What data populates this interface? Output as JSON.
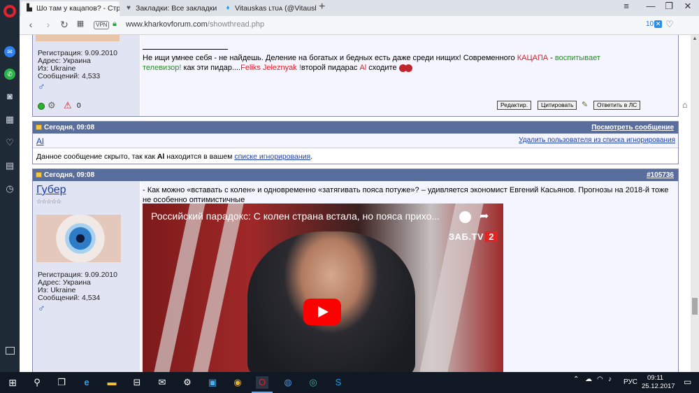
{
  "tabs": [
    {
      "title": "Шо там у кацапов? - Стра",
      "icon": "opera-page-icon",
      "active": true
    },
    {
      "title": "Закладки: Все закладки",
      "icon": "heart-icon",
      "active": false
    },
    {
      "title": "Vitauskas ʟтᴜᴀ (@Vitauskas",
      "icon": "twitter-icon",
      "active": false
    }
  ],
  "address": {
    "vpn": "VPN",
    "host": "www.kharkovforum.com",
    "path": "/showthread.php",
    "badge_count": "10"
  },
  "post1": {
    "reg": "Регистрация: 9.09.2010",
    "addr": "Адрес: Украина",
    "from": "Из: Ukraine",
    "msgs": "Сообщений: 4,533",
    "sig_line1_a": "Не ищи умнее себя - не найдешь. Деление на богатых и бедных есть даже среди нищих! Современного ",
    "sig_red1": "КАЦАПА",
    "sig_sep": " - ",
    "sig_green1": "воспитывает",
    "sig_green2": "телевизор!",
    "sig_line2_b": " как эти пидар....",
    "sig_red2": "Feliks Jeleznyak !",
    "sig_line2_c": "второй пидарас ",
    "sig_red3": "Al",
    "sig_line2_d": " сходите ",
    "btn_edit": "Редактир.",
    "btn_quote": "Цитировать",
    "btn_reply_pm": "Ответить в ЛС",
    "status_count": "0"
  },
  "post2": {
    "date": "Сегодня, 09:08",
    "view": "Посмотреть сообщение",
    "user": "Al",
    "remove_ignore": "Удалить пользователя из списка игнорирования",
    "hidden_a": "Данное сообщение скрыто, так как ",
    "hidden_user": "Al",
    "hidden_b": " находится в вашем ",
    "hidden_link": "списке игнорирования",
    "hidden_c": "."
  },
  "post3": {
    "date": "Сегодня, 09:08",
    "num_prefix": "#",
    "num": "105736",
    "user": "Губер",
    "stars": "☆☆☆☆☆",
    "reg": "Регистрация: 9.09.2010",
    "addr": "Адрес: Украина",
    "from": "Из: Ukraine",
    "msgs": "Сообщений: 4,534",
    "text": "- Как можно «вставать с колен» и одновременно «затягивать пояса потуже»? – удивляется экономист Евгений Касьянов. Прогнозы на 2018-й тоже не особенно оптимистичные",
    "video_title": "Российский парадокс: С колен страна встала, но пояса прихо...",
    "video_logo": "ЗАБ.TV",
    "video_logo_num": "2"
  },
  "taskbar": {
    "lang": "РУС",
    "time": "09:11",
    "date": "25.12.2017"
  }
}
